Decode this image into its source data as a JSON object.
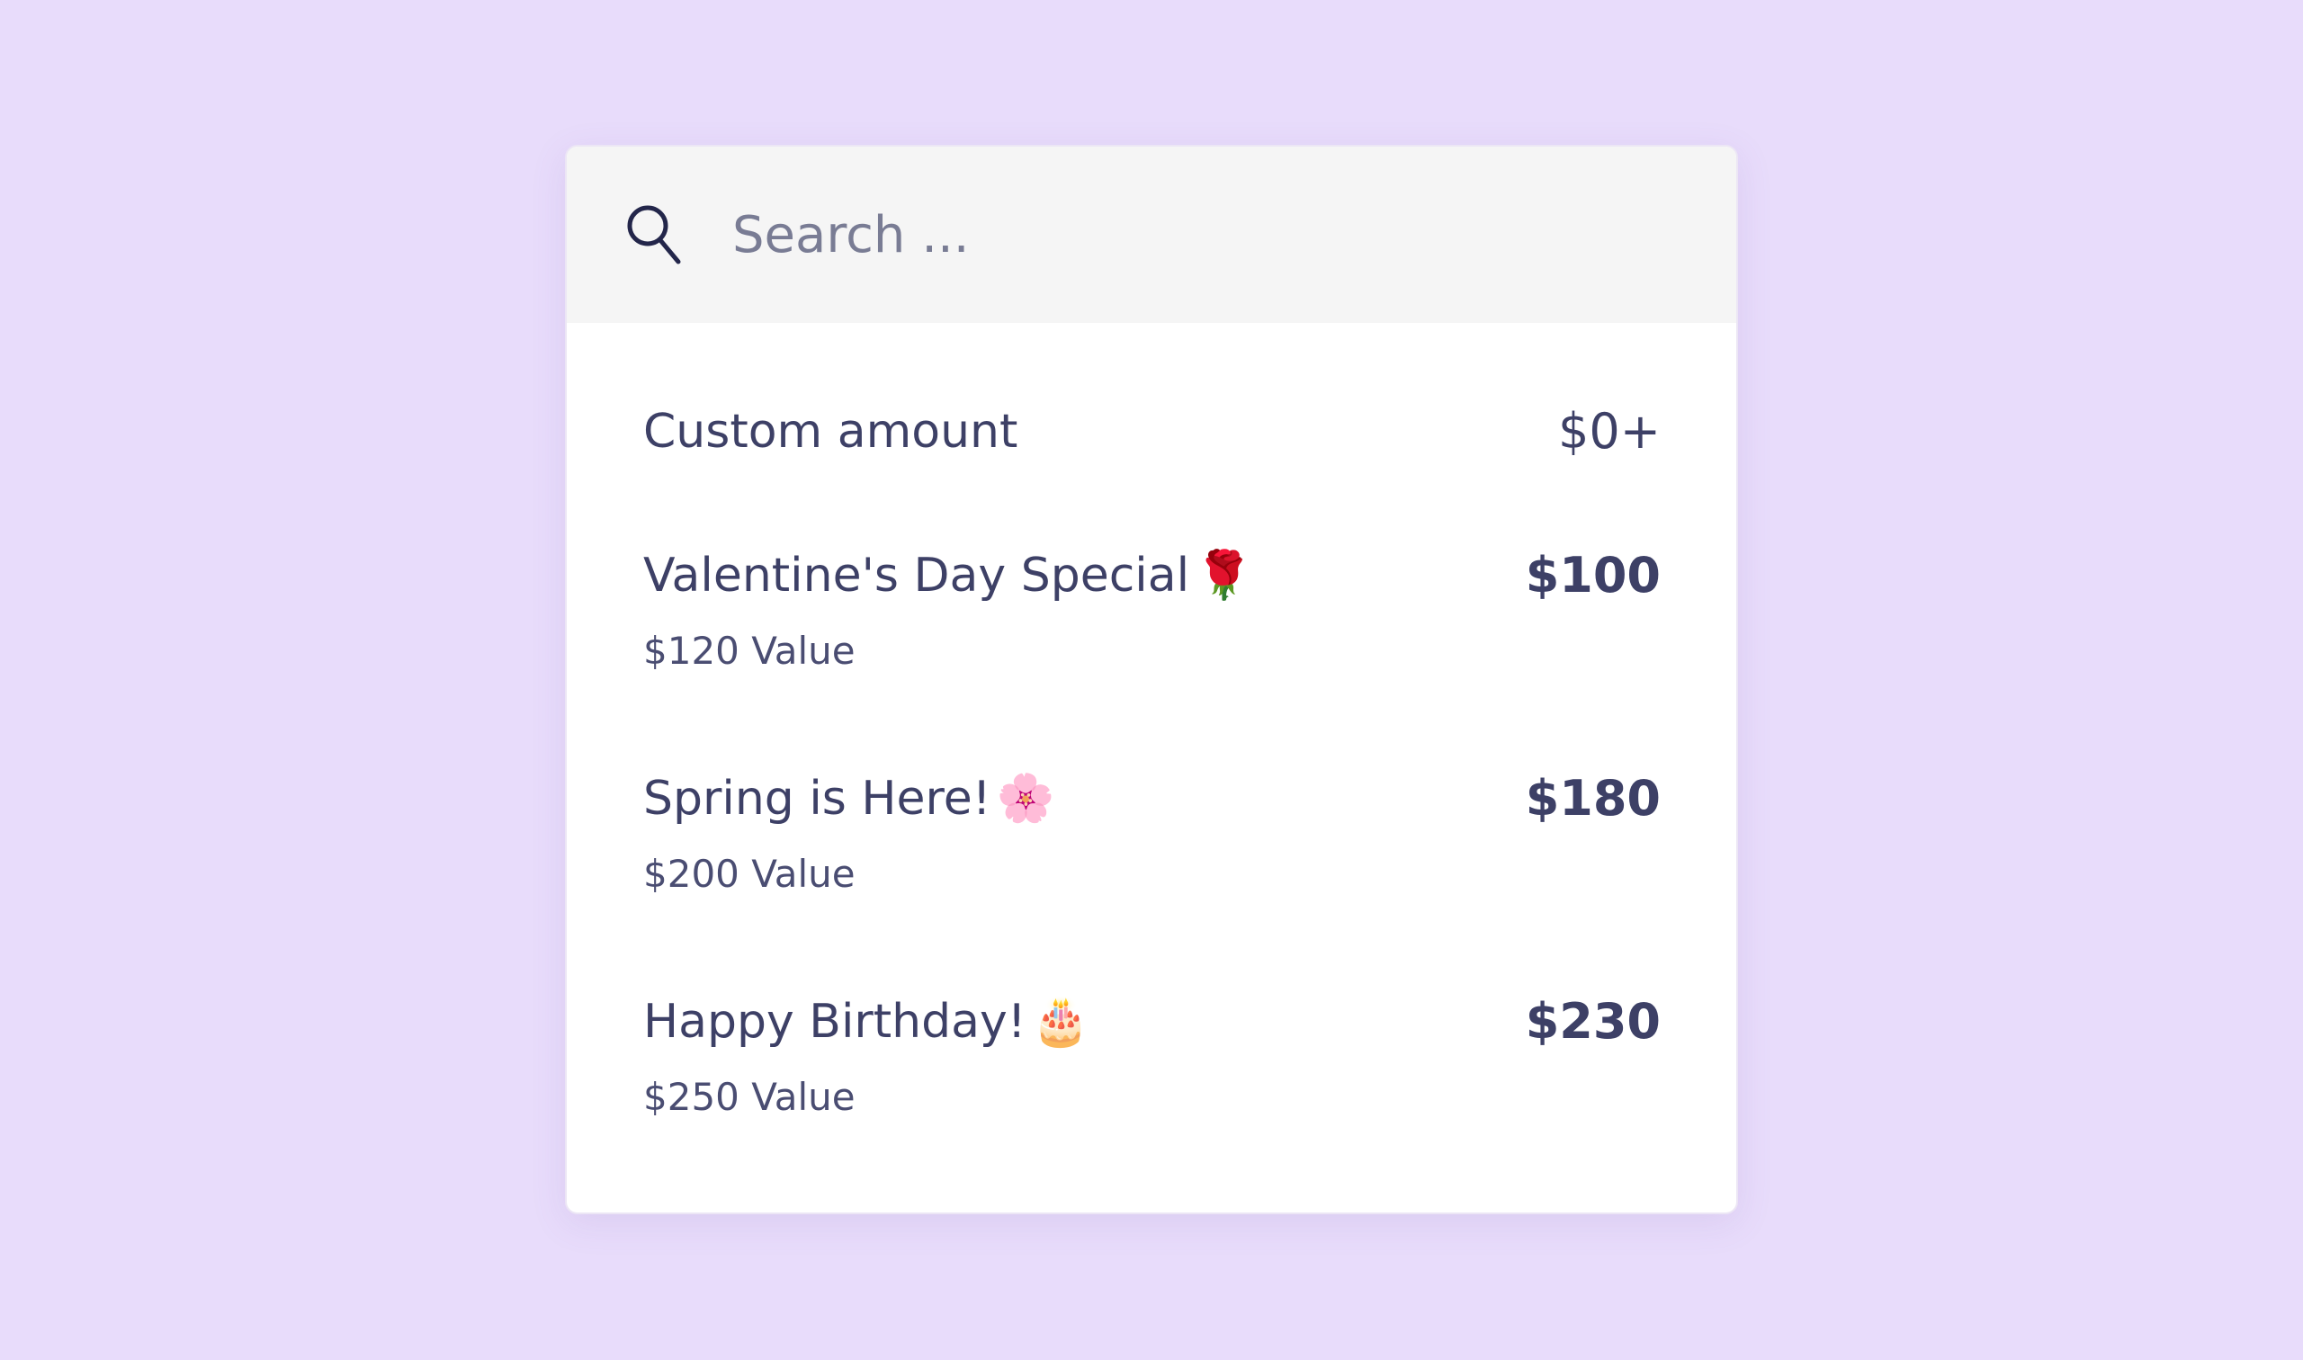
{
  "search": {
    "placeholder": "Search ...",
    "value": ""
  },
  "items": [
    {
      "name": "Custom amount",
      "price": "$0+",
      "value": ""
    },
    {
      "name": "Valentine's Day Special",
      "emoji": "🌹",
      "price": "$100",
      "value": "$120 Value"
    },
    {
      "name": "Spring is Here!",
      "emoji": "🌸",
      "price": "$180",
      "value": "$200 Value"
    },
    {
      "name": "Happy Birthday!",
      "emoji": "🎂",
      "price": "$230",
      "value": "$250 Value"
    }
  ],
  "colors": {
    "background": "#e8dcfb",
    "card": "#ffffff",
    "search_bar": "#f5f5f5",
    "text": "#3d4066"
  }
}
